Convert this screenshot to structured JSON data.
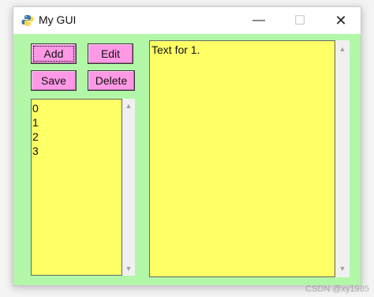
{
  "window": {
    "title": "My GUI",
    "minimize": "—",
    "maximize": "☐",
    "close": "✕",
    "background_color": "#b2f7a8"
  },
  "buttons": {
    "add": "Add",
    "edit": "Edit",
    "save": "Save",
    "delete": "Delete",
    "color": "#ff99e6"
  },
  "listbox": {
    "items": [
      "0",
      "1",
      "2",
      "3"
    ],
    "background_color": "#ffff66"
  },
  "text_area": {
    "content": "Text for 1."
  },
  "scroll": {
    "up": "▲",
    "down": "▼"
  },
  "watermark": "CSDN @xy1985"
}
